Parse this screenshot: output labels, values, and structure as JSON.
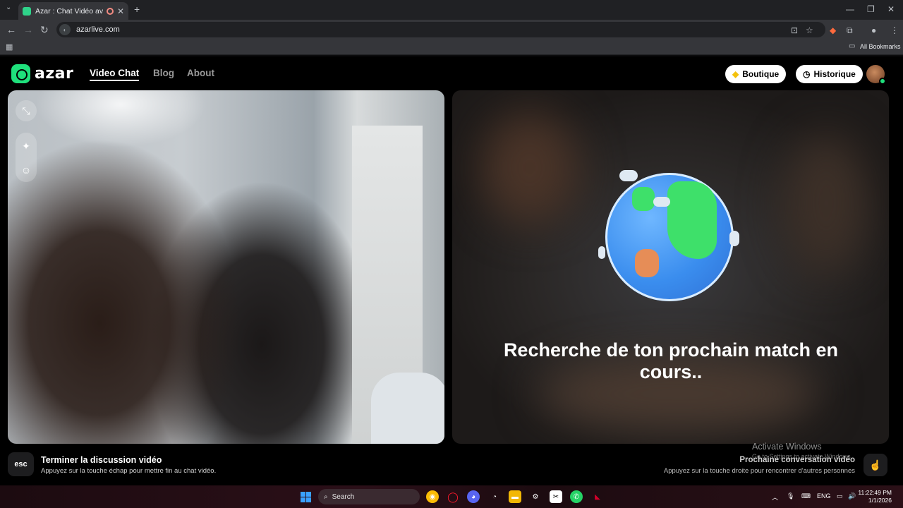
{
  "browser": {
    "tab_title": "Azar : Chat Vidéo avec de n",
    "url": "azarlive.com",
    "bookmarks_label": "All Bookmarks"
  },
  "header": {
    "logo_text": "azar",
    "nav": [
      "Video Chat",
      "Blog",
      "About"
    ],
    "boutique_label": "Boutique",
    "historique_label": "Historique"
  },
  "match": {
    "status_text": "Recherche de ton prochain match en cours.."
  },
  "footer": {
    "esc_key": "esc",
    "end_title": "Terminer la discussion vidéo",
    "end_subtitle": "Appuyez sur la touche échap pour mettre fin au chat vidéo.",
    "next_title": "Prochaine conversation vidéo",
    "next_subtitle": "Appuyez sur la touche droite pour rencontrer d'autres personnes"
  },
  "watermark": {
    "line1": "Activate Windows",
    "line2": "Go to Settings to activate Windows."
  },
  "taskbar": {
    "search_label": "Search",
    "language": "ENG",
    "time": "11:22:49 PM",
    "date": "1/1/2026"
  },
  "colors": {
    "brand_green": "#1fe07c",
    "pill_bg": "#ffffff"
  }
}
